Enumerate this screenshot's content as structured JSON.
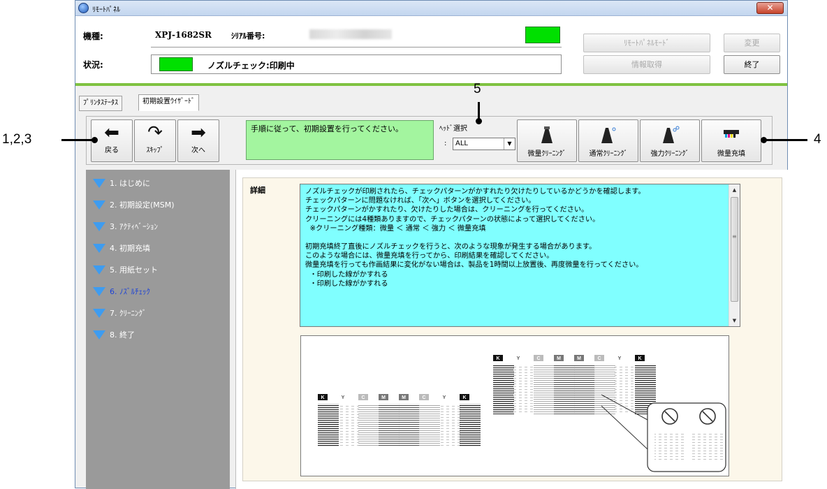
{
  "window": {
    "title": "ﾘﾓｰﾄﾊﾟﾈﾙ",
    "close_label": "✕"
  },
  "info": {
    "model_label": "機種:",
    "model_value": "XPJ-1682SR",
    "serial_label": "ｼﾘｱﾙ番号:",
    "status_label": "状況:",
    "status_text": "ノズルチェック:印刷中",
    "status_color": "#00e000"
  },
  "header_buttons": {
    "remote_panel_mode": "ﾘﾓｰﾄﾊﾟﾈﾙﾓｰﾄﾞ",
    "change": "変更",
    "get_info": "情報取得",
    "exit": "終了"
  },
  "tabs": [
    {
      "label": "ﾌﾟﾘﾝﾀｽﾃｰﾀｽ",
      "active": false
    },
    {
      "label": "初期設置ｳｲｻﾞｰﾄﾞ",
      "active": true
    }
  ],
  "toolbar": {
    "back": "戻る",
    "skip": "ｽｷｯﾌﾟ",
    "next": "次へ",
    "message": "手順に従って、初期設置を行ってください。",
    "head_select_label": "ﾍｯﾄﾞ選択",
    "head_select_colon": ":",
    "head_select_value": "ALL",
    "micro_cleaning": "微量ｸﾘｰﾆﾝｸﾞ",
    "normal_cleaning": "通常ｸﾘｰﾆﾝｸﾞ",
    "strong_cleaning": "強力ｸﾘｰﾆﾝｸﾞ",
    "micro_fill": "微量充填"
  },
  "steps": [
    {
      "label": "1. はじめに",
      "current": false
    },
    {
      "label": "2. 初期設定(MSM)",
      "current": false
    },
    {
      "label": "3. ｱｸﾃｨﾍﾞｰｼｮﾝ",
      "current": false
    },
    {
      "label": "4. 初期充填",
      "current": false
    },
    {
      "label": "5. 用紙セット",
      "current": false
    },
    {
      "label": "6. ﾉｽﾞﾙﾁｪｯｸ",
      "current": true
    },
    {
      "label": "7. ｸﾘｰﾆﾝｸﾞ",
      "current": false
    },
    {
      "label": "8. 終了",
      "current": false
    }
  ],
  "detail": {
    "label": "詳細",
    "lines": [
      "ノズルチェックが印刷されたら、チェックパターンがかすれたり欠けたりしているかどうかを確認します。",
      "チェックパターンに問題なければ、「次へ」ボタンを選択してください。",
      "チェックパターンがかすれたり、欠けたりした場合は、クリーニングを行ってください。",
      "クリーニングには4種類ありますので、チェックパターンの状態によって選択してください。",
      "  ※クリーニング種類：微量 ＜ 通常 ＜ 強力 ＜ 微量充填",
      "",
      "初期充填終了直後にノズルチェックを行うと、次のような現象が発生する場合があります。",
      "このような場合には、微量充填を行ってから、印刷結果を確認してください。",
      "微量充填を行っても作画結果に変化がない場合は、製品を1時間以上放置後、再度微量を行ってください。",
      "  ・印刷した線がかすれる",
      "  ・印刷した線がかすれる"
    ]
  },
  "pattern": {
    "row_upper_labels": [
      "K",
      "Y",
      "C",
      "M",
      "M",
      "C",
      "Y",
      "K"
    ],
    "row_lower_labels": [
      "K",
      "Y",
      "C",
      "M",
      "M",
      "C",
      "Y",
      "K"
    ]
  },
  "callouts": {
    "left": "1,2,3",
    "top": "5",
    "right": "4"
  }
}
